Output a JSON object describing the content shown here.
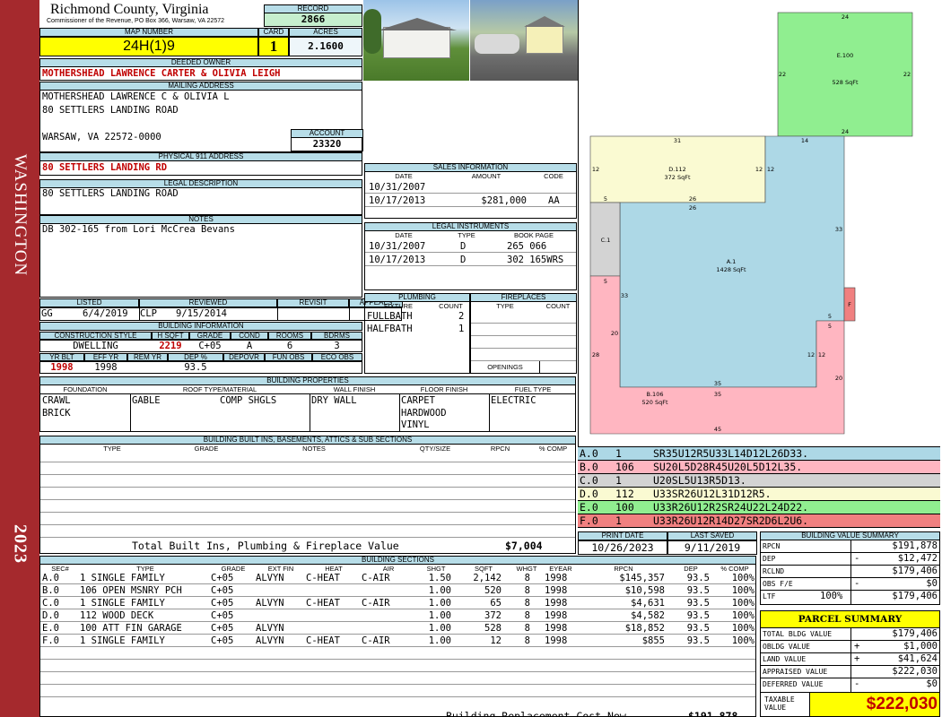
{
  "sidebar": {
    "district": "WASHINGTON",
    "year": "2023"
  },
  "county": {
    "title": "Richmond County, Virginia",
    "subtitle": "Commissioner of the Revenue, PO Box 366, Warsaw, VA 22572"
  },
  "record": {
    "label": "RECORD",
    "value": "2866"
  },
  "map_number": {
    "label": "MAP NUMBER",
    "value": "24H(1)9"
  },
  "card": {
    "label": "CARD",
    "value": "1"
  },
  "acres": {
    "label": "ACRES",
    "value": "2.1600"
  },
  "deeded_owner": {
    "label": "DEEDED OWNER",
    "value": "MOTHERSHEAD LAWRENCE CARTER & OLIVIA LEIGH"
  },
  "mailing": {
    "label": "MAILING ADDRESS",
    "line1": "MOTHERSHEAD LAWRENCE C & OLIVIA L",
    "line2": "80 SETTLERS LANDING ROAD",
    "line3": "WARSAW, VA 22572-0000"
  },
  "account": {
    "label": "ACCOUNT",
    "value": "23320"
  },
  "physical": {
    "label": "PHYSICAL 911 ADDRESS",
    "value": "80 SETTLERS LANDING RD"
  },
  "legal": {
    "label": "LEGAL DESCRIPTION",
    "value": "80 SETTLERS LANDING ROAD"
  },
  "notes": {
    "label": "NOTES",
    "value": "DB 302-165 from Lori McCrea Bevans"
  },
  "sales": {
    "label": "SALES INFORMATION",
    "headers": [
      "DATE",
      "AMOUNT",
      "CODE"
    ],
    "rows": [
      {
        "date": "10/31/2007",
        "amount": "",
        "code": ""
      },
      {
        "date": "10/17/2013",
        "amount": "$281,000",
        "code": "AA"
      }
    ]
  },
  "instruments": {
    "label": "LEGAL INSTRUMENTS",
    "headers": [
      "DATE",
      "TYPE",
      "BOOK PAGE"
    ],
    "rows": [
      {
        "date": "10/31/2007",
        "type": "D",
        "book": "265 066"
      },
      {
        "date": "10/17/2013",
        "type": "D",
        "book": "302 165WRS"
      }
    ]
  },
  "review": {
    "headers": [
      "LISTED",
      "REVIEWED",
      "REVISIT",
      "APPEALS"
    ],
    "listed_by": "GG",
    "listed_date": "6/4/2019",
    "reviewed_by": "CLP",
    "reviewed_date": "9/15/2014"
  },
  "building_info": {
    "label": "BUILDING INFORMATION",
    "headers1": [
      "CONSTRUCTION STYLE",
      "H SQFT",
      "GRADE",
      "COND",
      "ROOMS",
      "BDRMS"
    ],
    "values1": [
      "DWELLING",
      "2219",
      "C+05",
      "A",
      "6",
      "3"
    ],
    "headers2": [
      "YR BLT",
      "EFF YR",
      "REM YR",
      "DEP %",
      "DEPOVR",
      "FUN OBS",
      "ECO OBS"
    ],
    "values2": [
      "1998",
      "1998",
      "",
      "93.5",
      "",
      "",
      ""
    ]
  },
  "plumbing": {
    "label": "PLUMBING",
    "headers": [
      "FIXTURE",
      "COUNT"
    ],
    "rows": [
      {
        "fixture": "FULLBATH",
        "count": "2"
      },
      {
        "fixture": "HALFBATH",
        "count": "1"
      }
    ]
  },
  "fireplaces": {
    "label": "FIREPLACES",
    "headers": [
      "TYPE",
      "COUNT"
    ],
    "openings": "OPENINGS"
  },
  "properties": {
    "label": "BUILDING PROPERTIES",
    "headers": [
      "FOUNDATION",
      "ROOF TYPE/MATERIAL",
      "WALL FINISH",
      "FLOOR FINISH",
      "FUEL TYPE"
    ],
    "foundation": [
      "CRAWL",
      "BRICK"
    ],
    "roof_type": "GABLE",
    "roof_material": "COMP SHGLS",
    "wall": "DRY WALL",
    "floor": [
      "CARPET",
      "HARDWOOD",
      "VINYL"
    ],
    "fuel": "ELECTRIC"
  },
  "builtins": {
    "label": "BUILDING BUILT INS, BASEMENTS, ATTICS & SUB SECTIONS",
    "headers": [
      "TYPE",
      "GRADE",
      "NOTES",
      "QTY/SIZE",
      "RPCN",
      "% COMP"
    ],
    "total_label": "Total Built Ins, Plumbing & Fireplace Value",
    "total_value": "$7,004"
  },
  "dates": {
    "headers": [
      "PRINT DATE",
      "LAST SAVED"
    ],
    "print": "10/26/2023",
    "saved": "9/11/2019"
  },
  "vectors": [
    {
      "code": "A.0",
      "num": "1",
      "vector": "SR35U12R5U33L14D12L26D33.",
      "color": "#add8e6"
    },
    {
      "code": "B.0",
      "num": "106",
      "vector": "SU20L5D28R45U20L5D12L35.",
      "color": "#ffb6c1"
    },
    {
      "code": "C.0",
      "num": "1",
      "vector": "U20SL5U13R5D13.",
      "color": "#d3d3d3"
    },
    {
      "code": "D.0",
      "num": "112",
      "vector": "U33SR26U12L31D12R5.",
      "color": "#fafad2"
    },
    {
      "code": "E.0",
      "num": "100",
      "vector": "U33R26U12R2SR24U22L24D22.",
      "color": "#90ee90"
    },
    {
      "code": "F.0",
      "num": "1",
      "vector": "U33R26U12R14D27SR2D6L2U6.",
      "color": "#f08080"
    }
  ],
  "sketch": {
    "e_label": "E.100",
    "e_area": "528 SqFt",
    "d_label": "D.112",
    "d_area": "372 SqFt",
    "a_label": "A.1",
    "a_area": "1428 SqFt",
    "b_label": "B.106",
    "b_area": "520 SqFt",
    "c_label": "C.1",
    "f_label": "F",
    "dims": {
      "e_top": "24",
      "e_left": "22",
      "e_right": "22",
      "e_bottom": "24",
      "d_top": "31",
      "d_left": "12",
      "d_right": "12",
      "a_right_top": "14",
      "a_right": "33",
      "a_left": "33",
      "d_bottom": "26",
      "a_top_26": "26",
      "c_5": "5",
      "c_5b": "5",
      "a_12": "12",
      "b_20": "20",
      "b_28": "28",
      "b_35": "35",
      "b_45": "45",
      "b_20r": "20",
      "b_12": "12",
      "b_5": "5",
      "b_5b": "5"
    }
  },
  "building_value": {
    "label": "BUILDING VALUE SUMMARY",
    "rows": [
      {
        "label": "RPCN",
        "sign": "",
        "pct": "",
        "value": "$191,878"
      },
      {
        "label": "DEP",
        "sign": "-",
        "pct": "",
        "value": "$12,472"
      },
      {
        "label": "RCLND",
        "sign": "",
        "pct": "",
        "value": "$179,406"
      },
      {
        "label": "OBS F/E",
        "sign": "-",
        "pct": "",
        "value": "$0"
      },
      {
        "label": "LTF",
        "sign": "",
        "pct": "100%",
        "value": "$179,406"
      }
    ]
  },
  "parcel": {
    "label": "PARCEL SUMMARY",
    "rows": [
      {
        "label": "TOTAL BLDG VALUE",
        "sign": "",
        "value": "$179,406"
      },
      {
        "label": "OBLDG VALUE",
        "sign": "+",
        "value": "$1,000"
      },
      {
        "label": "LAND VALUE",
        "sign": "+",
        "value": "$41,624"
      },
      {
        "label": "APPRAISED VALUE",
        "sign": "",
        "value": "$222,030"
      },
      {
        "label": "DEFERRED VALUE",
        "sign": "-",
        "value": "$0"
      }
    ],
    "taxable_label1": "TAXABLE",
    "taxable_label2": "VALUE",
    "taxable_value": "$222,030"
  },
  "sections": {
    "label": "BUILDING SECTIONS",
    "headers": [
      "SEC#",
      "TYPE",
      "GRADE",
      "EXT FIN",
      "HEAT",
      "AIR",
      "SHGT",
      "SQFT",
      "WHGT",
      "EYEAR",
      "RPCN",
      "DEP",
      "% COMP"
    ],
    "rows": [
      [
        "A.0",
        "1 SINGLE FAMILY",
        "C+05",
        "ALVYN",
        "C-HEAT",
        "C-AIR",
        "1.50",
        "2,142",
        "8",
        "1998",
        "$145,357",
        "93.5",
        "100%"
      ],
      [
        "B.0",
        "106 OPEN MSNRY PCH",
        "C+05",
        "",
        "",
        "",
        "1.00",
        "520",
        "8",
        "1998",
        "$10,598",
        "93.5",
        "100%"
      ],
      [
        "C.0",
        "1 SINGLE FAMILY",
        "C+05",
        "ALVYN",
        "C-HEAT",
        "C-AIR",
        "1.00",
        "65",
        "8",
        "1998",
        "$4,631",
        "93.5",
        "100%"
      ],
      [
        "D.0",
        "112 WOOD DECK",
        "C+05",
        "",
        "",
        "",
        "1.00",
        "372",
        "8",
        "1998",
        "$4,582",
        "93.5",
        "100%"
      ],
      [
        "E.0",
        "100 ATT FIN GARAGE",
        "C+05",
        "ALVYN",
        "",
        "",
        "1.00",
        "528",
        "8",
        "1998",
        "$18,852",
        "93.5",
        "100%"
      ],
      [
        "F.0",
        "1 SINGLE FAMILY",
        "C+05",
        "ALVYN",
        "C-HEAT",
        "C-AIR",
        "1.00",
        "12",
        "8",
        "1998",
        "$855",
        "93.5",
        "100%"
      ]
    ],
    "total_label": "Building Replacement Cost New",
    "total_value": "$191,878"
  }
}
